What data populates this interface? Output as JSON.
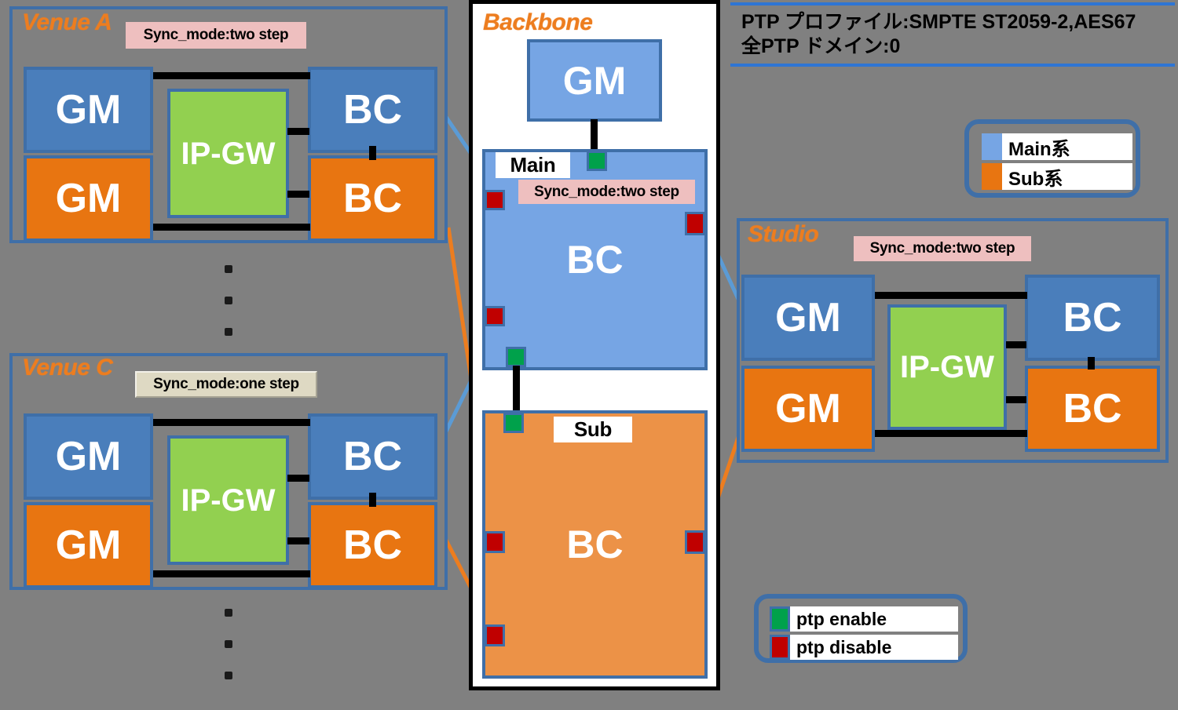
{
  "header": {
    "line1": "PTP プロファイル:SMPTE ST2059-2,AES67",
    "line2": "全PTP ドメイン:0"
  },
  "legend_system": {
    "items": [
      {
        "label": "Main系",
        "color": "#76A5E4",
        "swatch": "blue"
      },
      {
        "label": "Sub系",
        "color": "#E87511",
        "swatch": "orange"
      }
    ]
  },
  "legend_ptp": {
    "items": [
      {
        "label": "ptp enable",
        "color": "#00A14B",
        "swatch": "greenbox"
      },
      {
        "label": "ptp disable",
        "color": "#C00000",
        "swatch": "redbox"
      }
    ]
  },
  "sites": [
    {
      "id": "venue-a",
      "title": "Venue A",
      "sync_mode": "Sync_mode:two step",
      "sync_style": "pink",
      "nodes": [
        {
          "name": "gm-main",
          "label": "GM",
          "kind": "blue"
        },
        {
          "name": "gm-sub",
          "label": "GM",
          "kind": "orange"
        },
        {
          "name": "ip-gw",
          "label": "IP-GW",
          "kind": "green"
        },
        {
          "name": "bc-main",
          "label": "BC",
          "kind": "blue"
        },
        {
          "name": "bc-sub",
          "label": "BC",
          "kind": "orange"
        }
      ]
    },
    {
      "id": "venue-c",
      "title": "Venue C",
      "sync_mode": "Sync_mode:one step",
      "sync_style": "beige",
      "nodes": [
        {
          "name": "gm-main",
          "label": "GM",
          "kind": "blue"
        },
        {
          "name": "gm-sub",
          "label": "GM",
          "kind": "orange"
        },
        {
          "name": "ip-gw",
          "label": "IP-GW",
          "kind": "green"
        },
        {
          "name": "bc-main",
          "label": "BC",
          "kind": "blue"
        },
        {
          "name": "bc-sub",
          "label": "BC",
          "kind": "orange"
        }
      ]
    },
    {
      "id": "studio",
      "title": "Studio",
      "sync_mode": "Sync_mode:two step",
      "sync_style": "pink",
      "nodes": [
        {
          "name": "gm-main",
          "label": "GM",
          "kind": "blue"
        },
        {
          "name": "gm-sub",
          "label": "GM",
          "kind": "orange"
        },
        {
          "name": "ip-gw",
          "label": "IP-GW",
          "kind": "green"
        },
        {
          "name": "bc-main",
          "label": "BC",
          "kind": "blue"
        },
        {
          "name": "bc-sub",
          "label": "BC",
          "kind": "orange"
        }
      ]
    }
  ],
  "backbone": {
    "title": "Backbone",
    "gm_label": "GM",
    "main": {
      "badge": "Main",
      "label": "BC",
      "sync_mode": "Sync_mode:two step",
      "ports": [
        {
          "name": "top-uplink",
          "state": "ptp enable"
        },
        {
          "name": "left-upper",
          "state": "ptp disable"
        },
        {
          "name": "right-upper",
          "state": "ptp disable"
        },
        {
          "name": "left-lower",
          "state": "ptp disable"
        },
        {
          "name": "bottom-downlink",
          "state": "ptp enable"
        }
      ]
    },
    "sub": {
      "badge": "Sub",
      "label": "BC",
      "ports": [
        {
          "name": "top-uplink",
          "state": "ptp enable"
        },
        {
          "name": "left-upper",
          "state": "ptp disable"
        },
        {
          "name": "right-mid",
          "state": "ptp disable"
        },
        {
          "name": "left-lower",
          "state": "ptp disable"
        }
      ]
    }
  },
  "ellipsis": {
    "glyph": "."
  },
  "colors": {
    "background": "#808080",
    "frame_blue": "#3F6FA8",
    "main_blue": "#4A7EBB",
    "light_blue": "#76A5E4",
    "sub_orange": "#E87511",
    "gateway_green": "#92D050",
    "ptp_enable": "#00A14B",
    "ptp_disable": "#C00000",
    "title_orange": "#ED7D1F",
    "tag_pink": "#EEBFBF",
    "tag_beige": "#DED9C3"
  }
}
